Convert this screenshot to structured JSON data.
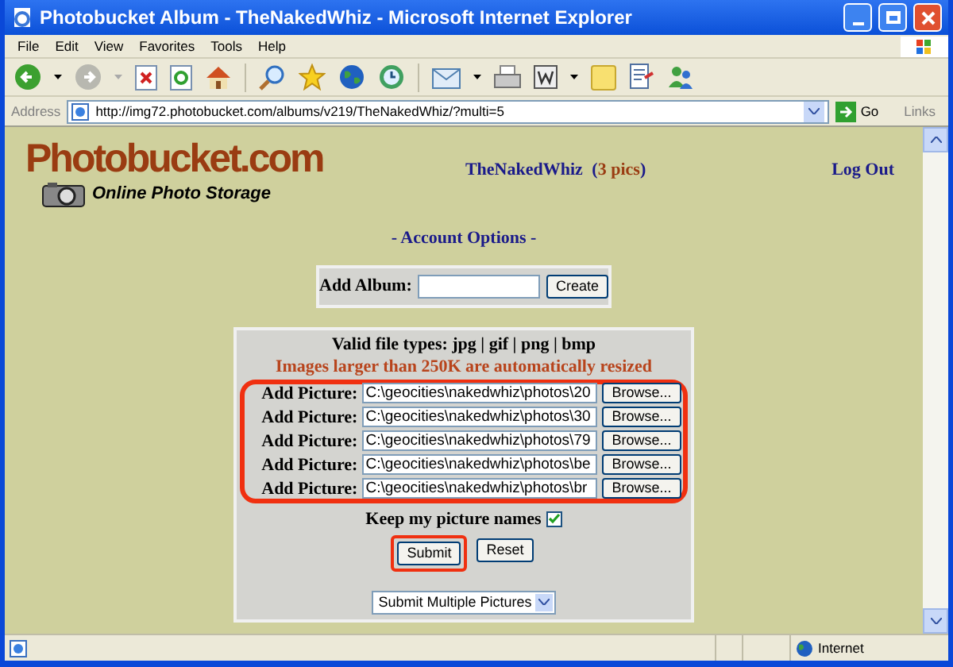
{
  "window": {
    "title": "Photobucket Album - TheNakedWhiz - Microsoft Internet Explorer"
  },
  "menu": [
    "File",
    "Edit",
    "View",
    "Favorites",
    "Tools",
    "Help"
  ],
  "address_bar": {
    "label": "Address",
    "url": "http://img72.photobucket.com/albums/v219/TheNakedWhiz/?multi=5",
    "go": "Go",
    "links": "Links"
  },
  "page": {
    "logo": {
      "title": "Photobucket.com",
      "tagline": "Online Photo Storage"
    },
    "user": {
      "name": "TheNakedWhiz",
      "open": "(",
      "count": "3 pics",
      "close": ")"
    },
    "logout": "Log Out",
    "section": "- Account Options -",
    "add_album": {
      "label": "Add Album:",
      "button": "Create"
    },
    "upload": {
      "file_types": "Valid file types: jpg | gif | png | bmp",
      "notice": "Images larger than 250K are automatically resized",
      "highlighted": true,
      "pictures": [
        {
          "label": "Add Picture:",
          "value": "C:\\geocities\\nakedwhiz\\photos\\20",
          "button": "Browse..."
        },
        {
          "label": "Add Picture:",
          "value": "C:\\geocities\\nakedwhiz\\photos\\30",
          "button": "Browse..."
        },
        {
          "label": "Add Picture:",
          "value": "C:\\geocities\\nakedwhiz\\photos\\79",
          "button": "Browse..."
        },
        {
          "label": "Add Picture:",
          "value": "C:\\geocities\\nakedwhiz\\photos\\be",
          "button": "Browse..."
        },
        {
          "label": "Add Picture:",
          "value": "C:\\geocities\\nakedwhiz\\photos\\br",
          "button": "Browse..."
        }
      ],
      "keep_names": {
        "label": "Keep my picture names",
        "checked": true
      },
      "submit": {
        "label": "Submit",
        "highlighted": true
      },
      "reset": "Reset",
      "mode": {
        "value": "Submit Multiple Pictures"
      }
    }
  },
  "status_bar": {
    "zone": "Internet"
  }
}
